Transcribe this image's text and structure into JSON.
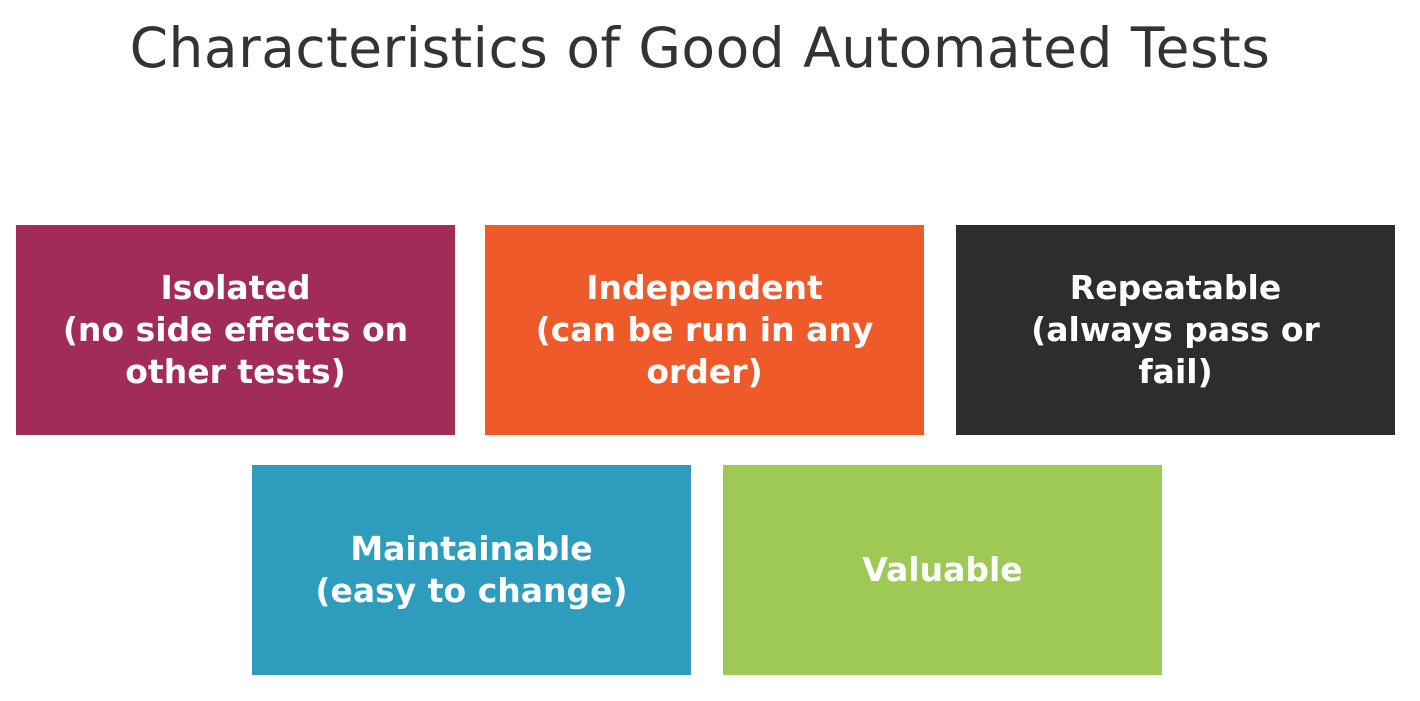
{
  "title": "Characteristics of Good Automated Tests",
  "cards": [
    {
      "name": "Isolated",
      "description": "(no side effects on other tests)",
      "color": "#a22c58"
    },
    {
      "name": "Independent",
      "description": "(can be run in any order)",
      "color": "#ef5a2a"
    },
    {
      "name": "Repeatable",
      "description": "(always pass or fail)",
      "color": "#2d2d2d"
    },
    {
      "name": "Maintainable",
      "description": "(easy to change)",
      "color": "#2e9dbd"
    },
    {
      "name": "Valuable",
      "description": "",
      "color": "#9ec955"
    }
  ]
}
